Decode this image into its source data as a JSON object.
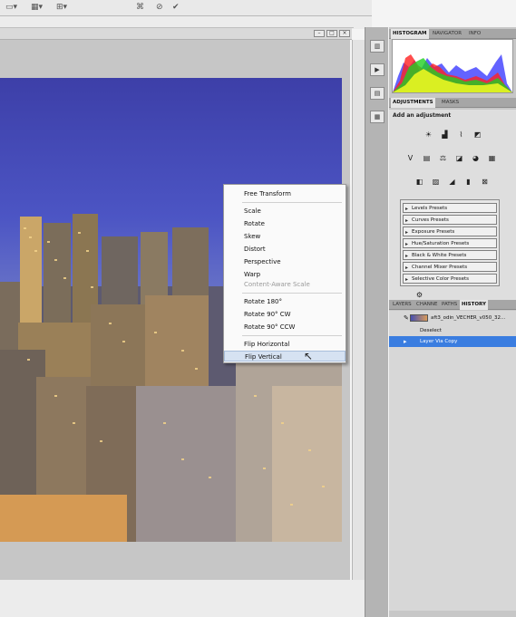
{
  "options_bar": {
    "icons": [
      "reference-point-icon",
      "interpolation-icon",
      "warp-toggle-icon",
      "cancel-transform-icon",
      "commit-transform-icon"
    ]
  },
  "context_menu": {
    "items": [
      {
        "label": "Free Transform",
        "enabled": true,
        "highlighted": false
      },
      {
        "label": "Scale",
        "enabled": true,
        "highlighted": false
      },
      {
        "label": "Rotate",
        "enabled": true,
        "highlighted": false
      },
      {
        "label": "Skew",
        "enabled": true,
        "highlighted": false
      },
      {
        "label": "Distort",
        "enabled": true,
        "highlighted": false
      },
      {
        "label": "Perspective",
        "enabled": true,
        "highlighted": false
      },
      {
        "label": "Warp",
        "enabled": true,
        "highlighted": false
      },
      {
        "label": "Content-Aware Scale",
        "enabled": false,
        "highlighted": false
      },
      {
        "label": "Rotate 180°",
        "enabled": true,
        "highlighted": false
      },
      {
        "label": "Rotate 90° CW",
        "enabled": true,
        "highlighted": false
      },
      {
        "label": "Rotate 90° CCW",
        "enabled": true,
        "highlighted": false
      },
      {
        "label": "Flip Horizontal",
        "enabled": true,
        "highlighted": false
      },
      {
        "label": "Flip Vertical",
        "enabled": true,
        "highlighted": true
      }
    ]
  },
  "histogram_panel": {
    "tabs": [
      "HISTOGRAM",
      "NAVIGATOR",
      "INFO"
    ],
    "active_tab": "HISTOGRAM"
  },
  "adjustments_panel": {
    "tabs": [
      "ADJUSTMENTS",
      "MASKS"
    ],
    "active_tab": "ADJUSTMENTS",
    "title": "Add an adjustment",
    "presets": [
      "Levels Presets",
      "Curves Presets",
      "Exposure Presets",
      "Hue/Saturation Presets",
      "Black & White Presets",
      "Channel Mixer Presets",
      "Selective Color Presets"
    ]
  },
  "history_panel": {
    "tabs": [
      "LAYERS",
      "CHANNE",
      "PATHS",
      "HISTORY"
    ],
    "active_tab": "HISTORY",
    "entries": [
      {
        "label": "aft3_odin_VECHER_v050_32...",
        "snapshot": true,
        "selected": false
      },
      {
        "label": "Deselect",
        "snapshot": false,
        "selected": false
      },
      {
        "label": "Layer Via Copy",
        "snapshot": false,
        "selected": true
      }
    ]
  },
  "colors": {
    "menu_highlight": "#d6e2f2",
    "history_selected": "#3a7de0",
    "panel_bg": "#c7c7c7"
  }
}
